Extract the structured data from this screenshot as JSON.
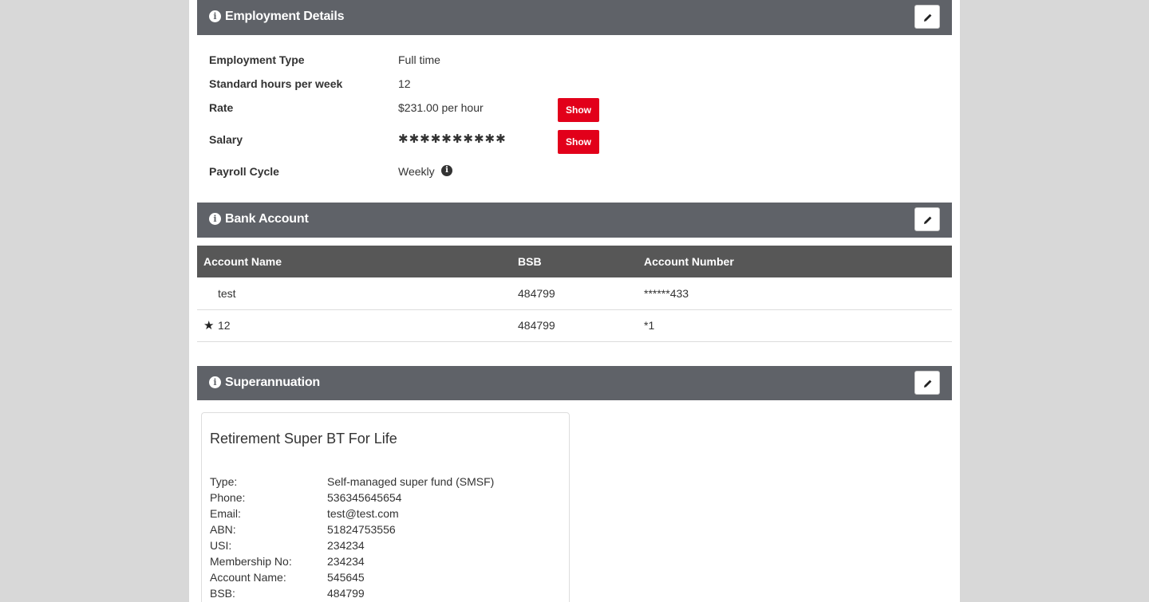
{
  "employment": {
    "title": "Employment Details",
    "rows": [
      {
        "label": "Employment Type",
        "value": "Full time"
      },
      {
        "label": "Standard hours per week",
        "value": "12"
      },
      {
        "label": "Rate",
        "value": "$231.00 per hour",
        "button": "Show"
      },
      {
        "label": "Salary",
        "value": "✱✱✱✱✱✱✱✱✱✱",
        "button": "Show"
      },
      {
        "label": "Payroll Cycle",
        "value": "Weekly"
      }
    ]
  },
  "bank": {
    "title": "Bank Account",
    "columns": [
      "Account Name",
      "BSB",
      "Account Number"
    ],
    "rows": [
      {
        "starred": false,
        "name": "test",
        "bsb": "484799",
        "number": "******433"
      },
      {
        "starred": true,
        "name": "12",
        "bsb": "484799",
        "number": "*1"
      }
    ]
  },
  "super": {
    "title": "Superannuation",
    "fund_name": "Retirement Super BT For Life",
    "details": [
      {
        "key": "Type:",
        "value": "Self-managed super fund (SMSF)"
      },
      {
        "key": "Phone:",
        "value": "536345645654"
      },
      {
        "key": "Email:",
        "value": "test@test.com"
      },
      {
        "key": "ABN:",
        "value": "51824753556"
      },
      {
        "key": "USI:",
        "value": "234234"
      },
      {
        "key": "Membership No:",
        "value": "234234"
      },
      {
        "key": "Account Name:",
        "value": "545645"
      },
      {
        "key": "BSB:",
        "value": "484799"
      }
    ]
  },
  "icons": {
    "info": "i",
    "star": "★",
    "edit": "pencil-icon"
  },
  "colors": {
    "header_bg": "#5f6268",
    "table_header_bg": "#575757",
    "show_button": "#e2001a",
    "page_bg": "#d8d8d8"
  }
}
